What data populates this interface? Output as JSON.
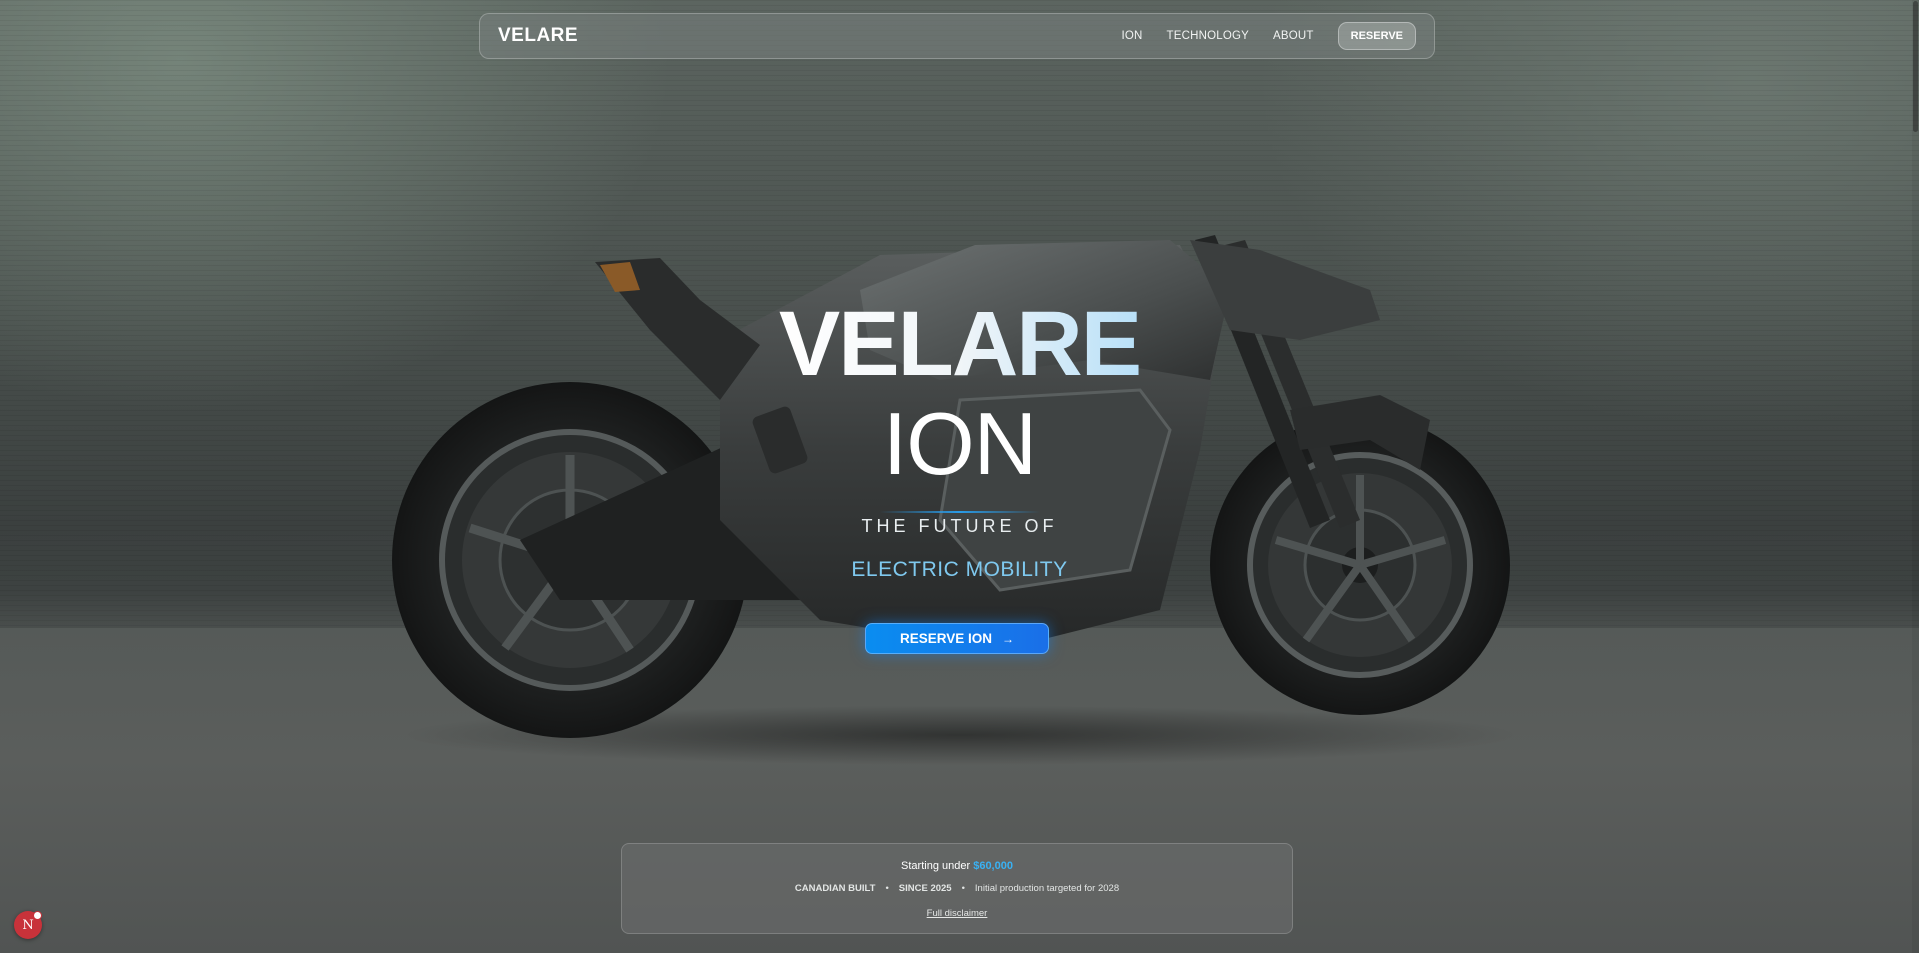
{
  "nav": {
    "logo": "VELARE",
    "links": [
      {
        "label": "ION"
      },
      {
        "label": "TECHNOLOGY"
      },
      {
        "label": "ABOUT"
      }
    ],
    "reserve_label": "RESERVE"
  },
  "hero": {
    "title": "VELARE",
    "subtitle": "ION",
    "tagline_top": "THE FUTURE OF",
    "tagline_bottom": "ELECTRIC MOBILITY",
    "cta_label": "RESERVE ION",
    "cta_icon": "arrow-right-icon"
  },
  "info": {
    "price_prefix": "Starting under",
    "price": "$60,000",
    "meta_built": "CANADIAN BUILT",
    "meta_since": "SINCE 2025",
    "meta_production": "Initial production targeted for 2028",
    "separator": "•",
    "disclaimer": "Full disclaimer"
  },
  "dev_badge": {
    "letter": "N",
    "icon": "nextjs-dev-indicator-icon"
  },
  "colors": {
    "accent": "#39b1f3",
    "cta": "#0a8df0",
    "badge": "#c8323a"
  }
}
